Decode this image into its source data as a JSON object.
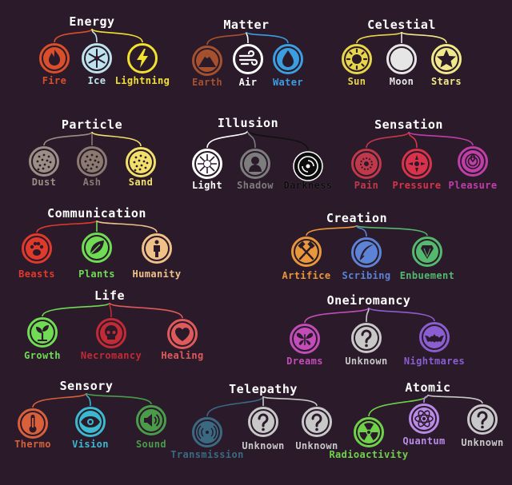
{
  "groups": [
    {
      "title": "Energy",
      "nodes": [
        {
          "label": "Fire",
          "color": "#d94f2b",
          "icon": "fire-icon"
        },
        {
          "label": "Ice",
          "color": "#bde3ee",
          "icon": "snowflake-icon"
        },
        {
          "label": "Lightning",
          "color": "#f2e12e",
          "icon": "lightning-icon"
        }
      ]
    },
    {
      "title": "Matter",
      "nodes": [
        {
          "label": "Earth",
          "color": "#a5512e",
          "icon": "mountain-icon"
        },
        {
          "label": "Air",
          "color": "#ffffff",
          "icon": "wind-icon"
        },
        {
          "label": "Water",
          "color": "#3b9ee0",
          "icon": "water-drop-icon"
        }
      ]
    },
    {
      "title": "Celestial",
      "nodes": [
        {
          "label": "Sun",
          "color": "#e8d64a",
          "icon": "sun-icon"
        },
        {
          "label": "Moon",
          "color": "#e6e6e6",
          "icon": "moon-icon"
        },
        {
          "label": "Stars",
          "color": "#f0e88a",
          "icon": "star-icon"
        }
      ]
    },
    {
      "title": "Particle",
      "nodes": [
        {
          "label": "Dust",
          "color": "#9b8f85",
          "icon": "dust-particles-icon"
        },
        {
          "label": "Ash",
          "color": "#8a7a70",
          "icon": "ash-particles-icon"
        },
        {
          "label": "Sand",
          "color": "#f2e06a",
          "icon": "sand-particles-icon"
        }
      ]
    },
    {
      "title": "Illusion",
      "nodes": [
        {
          "label": "Light",
          "color": "#ffffff",
          "icon": "light-burst-icon"
        },
        {
          "label": "Shadow",
          "color": "#7d7d7d",
          "icon": "silhouette-icon"
        },
        {
          "label": "Darkness",
          "color": "#111111",
          "icon": "vortex-icon"
        }
      ]
    },
    {
      "title": "Sensation",
      "nodes": [
        {
          "label": "Pain",
          "color": "#c0394a",
          "icon": "pain-burst-icon"
        },
        {
          "label": "Pressure",
          "color": "#d8334a",
          "icon": "pressure-icon"
        },
        {
          "label": "Pleasure",
          "color": "#bf3ea8",
          "icon": "rose-icon"
        }
      ]
    },
    {
      "title": "Communication",
      "nodes": [
        {
          "label": "Beasts",
          "color": "#e03a2c",
          "icon": "paw-icon"
        },
        {
          "label": "Plants",
          "color": "#6fdc54",
          "icon": "leaf-icon"
        },
        {
          "label": "Humanity",
          "color": "#f0c089",
          "icon": "person-icon"
        }
      ]
    },
    {
      "title": "Creation",
      "nodes": [
        {
          "label": "Artifice",
          "color": "#e8973a",
          "icon": "hammers-icon"
        },
        {
          "label": "Scribing",
          "color": "#5c83d6",
          "icon": "quill-icon"
        },
        {
          "label": "Enbuement",
          "color": "#54b86e",
          "icon": "gem-icon"
        }
      ]
    },
    {
      "title": "Life",
      "nodes": [
        {
          "label": "Growth",
          "color": "#6fdc54",
          "icon": "sprout-icon"
        },
        {
          "label": "Necromancy",
          "color": "#c22a35",
          "icon": "skull-icon"
        },
        {
          "label": "Healing",
          "color": "#e05a5a",
          "icon": "heart-icon"
        }
      ]
    },
    {
      "title": "Oneiromancy",
      "nodes": [
        {
          "label": "Dreams",
          "color": "#c24db8",
          "icon": "butterfly-icon"
        },
        {
          "label": "Unknown",
          "color": "#c8c8c8",
          "icon": "question-mark-icon"
        },
        {
          "label": "Nightmares",
          "color": "#8a5ed0",
          "icon": "bat-icon"
        }
      ]
    },
    {
      "title": "Sensory",
      "nodes": [
        {
          "label": "Thermo",
          "color": "#d9603a",
          "icon": "thermometer-icon"
        },
        {
          "label": "Vision",
          "color": "#3cb8cf",
          "icon": "eye-icon"
        },
        {
          "label": "Sound",
          "color": "#4a9c4a",
          "icon": "speaker-icon"
        }
      ]
    },
    {
      "title": "Telepathy",
      "nodes": [
        {
          "label": "Transmission",
          "color": "#3a6a82",
          "icon": "signal-icon"
        },
        {
          "label": "Unknown",
          "color": "#c8c8c8",
          "icon": "question-mark-icon"
        },
        {
          "label": "Unknown",
          "color": "#c8c8c8",
          "icon": "question-mark-icon"
        }
      ]
    },
    {
      "title": "Atomic",
      "nodes": [
        {
          "label": "Radioactivity",
          "color": "#6fd24a",
          "icon": "radiation-icon"
        },
        {
          "label": "Quantum",
          "color": "#b98ae8",
          "icon": "atom-icon"
        },
        {
          "label": "Unknown",
          "color": "#c8c8c8",
          "icon": "question-mark-icon"
        }
      ]
    }
  ]
}
